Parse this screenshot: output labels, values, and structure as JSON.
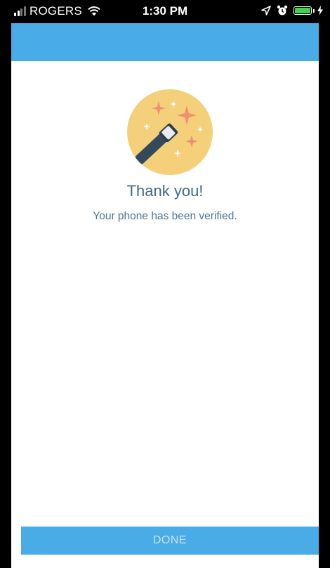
{
  "status_bar": {
    "carrier": "ROGERS",
    "time": "1:30 PM",
    "battery_color": "#3fd44a",
    "icons": [
      "signal-icon",
      "wifi-icon",
      "location-icon",
      "alarm-icon",
      "battery-icon",
      "charging-icon"
    ]
  },
  "header": {
    "background_color": "#4aace6"
  },
  "content": {
    "illustration": "magic-wand-icon",
    "title": "Thank you!",
    "message": "Your phone has been verified."
  },
  "actions": {
    "done_label": "DONE"
  }
}
